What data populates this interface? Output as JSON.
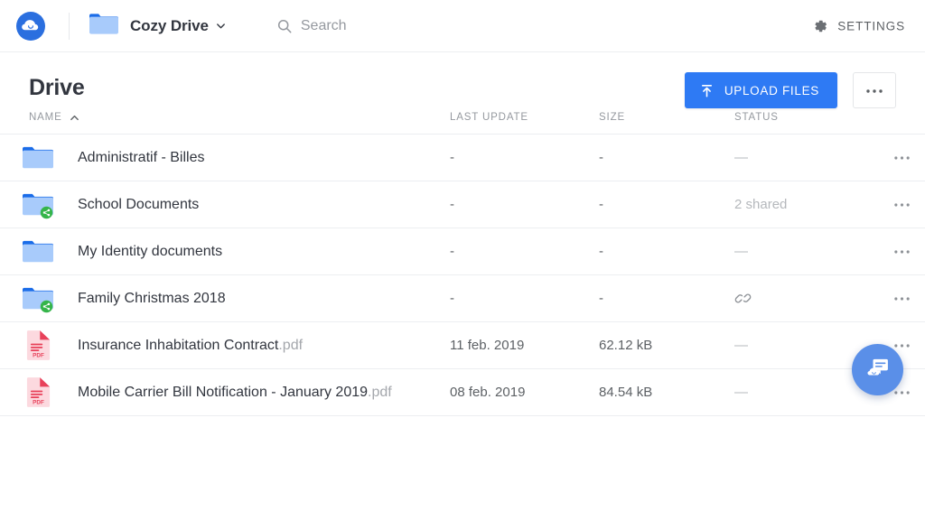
{
  "topbar": {
    "logo_icon": "cozy-cloud-logo",
    "app_icon": "folder-icon",
    "app_title": "Cozy Drive",
    "app_chevron_icon": "chevron-down-icon",
    "search": {
      "icon": "search-icon",
      "placeholder": "Search",
      "value": ""
    },
    "settings": {
      "icon": "gear-icon",
      "label": "SETTINGS"
    }
  },
  "page": {
    "title": "Drive",
    "upload_button": {
      "label": "UPLOAD FILES",
      "icon": "upload-arrow-icon"
    },
    "more_button": {
      "icon": "ellipsis-icon"
    }
  },
  "table": {
    "columns": {
      "name": "NAME",
      "last_update": "LAST UPDATE",
      "size": "SIZE",
      "status": "STATUS"
    },
    "sort": {
      "column": "NAME",
      "direction": "asc",
      "icon": "chevron-up-icon"
    },
    "rows": [
      {
        "icon": "folder-icon",
        "shared_badge": false,
        "name": "Administratif - Billes",
        "ext": "",
        "last_update": "-",
        "size": "-",
        "status_text": "—",
        "status_icon": ""
      },
      {
        "icon": "folder-icon",
        "shared_badge": true,
        "name": "School Documents",
        "ext": "",
        "last_update": "-",
        "size": "-",
        "status_text": "2 shared",
        "status_icon": ""
      },
      {
        "icon": "folder-icon",
        "shared_badge": false,
        "name": "My Identity documents",
        "ext": "",
        "last_update": "-",
        "size": "-",
        "status_text": "—",
        "status_icon": ""
      },
      {
        "icon": "folder-icon",
        "shared_badge": true,
        "name": "Family Christmas 2018",
        "ext": "",
        "last_update": "-",
        "size": "-",
        "status_text": "",
        "status_icon": "link-icon"
      },
      {
        "icon": "pdf-file-icon",
        "shared_badge": false,
        "name": "Insurance Inhabitation Contract",
        "ext": ".pdf",
        "last_update": "11 feb. 2019",
        "size": "62.12 kB",
        "status_text": "—",
        "status_icon": ""
      },
      {
        "icon": "pdf-file-icon",
        "shared_badge": false,
        "name": "Mobile Carrier Bill Notification - January 2019",
        "ext": ".pdf",
        "last_update": "08 feb. 2019",
        "size": "84.54 kB",
        "status_text": "—",
        "status_icon": ""
      }
    ],
    "row_menu_icon": "ellipsis-icon"
  },
  "fab": {
    "icon": "chat-bubble-icon"
  },
  "colors": {
    "accent_blue": "#2e7af4",
    "logo_blue": "#2b6fdf",
    "folder_light": "#a8cbfb",
    "folder_dark": "#1a6ce8",
    "shared_green": "#35b54a",
    "pdf_light": "#fcd9df",
    "pdf_dark": "#e8415a",
    "text_dark": "#32363f",
    "text_muted": "#95999f",
    "divider": "#eceef1",
    "fab_blue": "#5a8fe8"
  }
}
